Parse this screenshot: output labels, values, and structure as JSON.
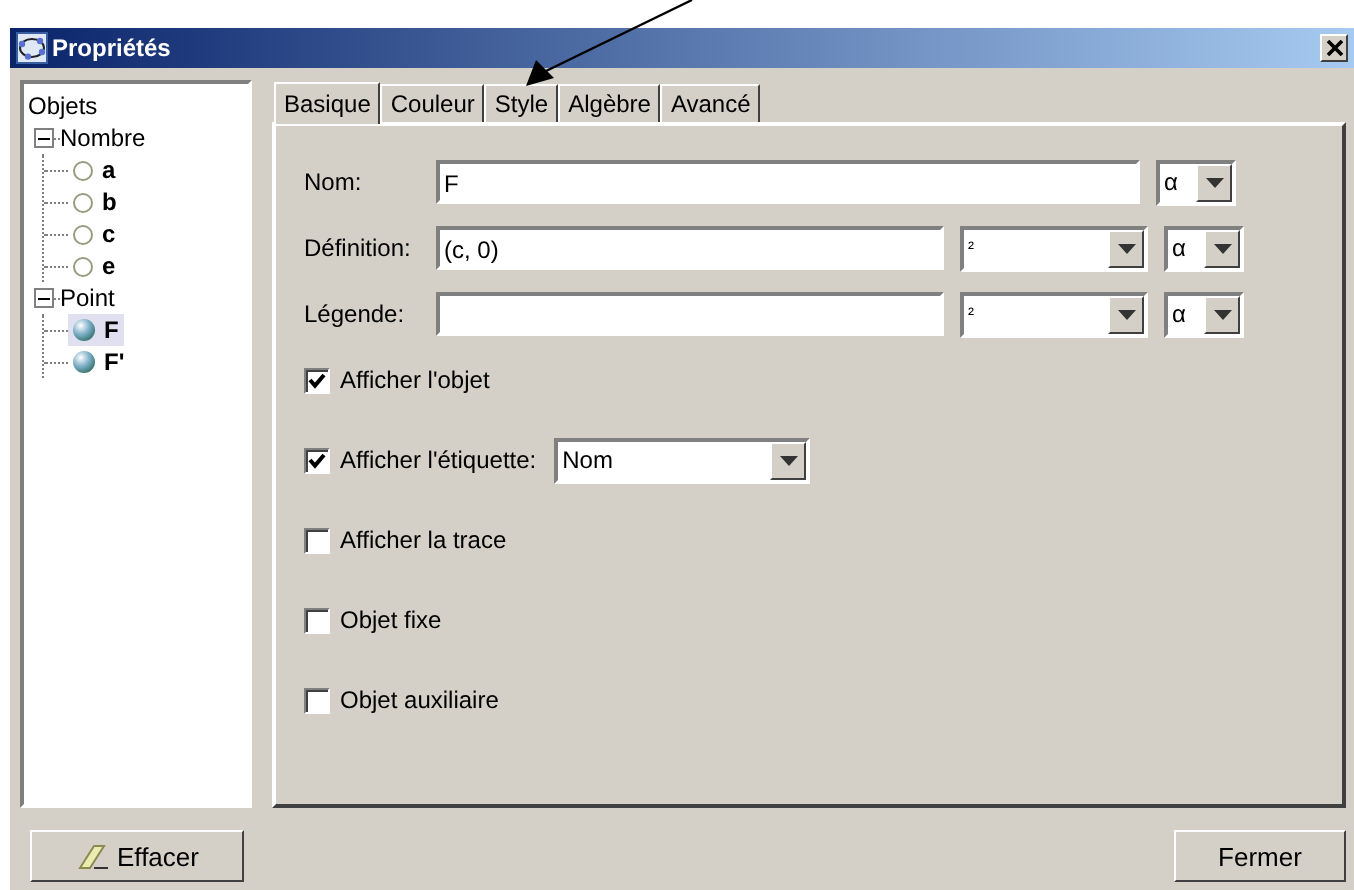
{
  "window": {
    "title": "Propriétés"
  },
  "tree": {
    "label": "Objets",
    "children": [
      {
        "label": "Nombre",
        "expanded": true,
        "children": [
          {
            "label": "a",
            "kind": "number",
            "selected": false
          },
          {
            "label": "b",
            "kind": "number",
            "selected": false
          },
          {
            "label": "c",
            "kind": "number",
            "selected": false
          },
          {
            "label": "e",
            "kind": "number",
            "selected": false
          }
        ]
      },
      {
        "label": "Point",
        "expanded": true,
        "children": [
          {
            "label": "F",
            "kind": "point",
            "selected": true
          },
          {
            "label": "F'",
            "kind": "point",
            "selected": false
          }
        ]
      }
    ]
  },
  "tabs": [
    {
      "label": "Basique",
      "selected": true
    },
    {
      "label": "Couleur",
      "selected": false
    },
    {
      "label": "Style",
      "selected": false
    },
    {
      "label": "Algèbre",
      "selected": false
    },
    {
      "label": "Avancé",
      "selected": false
    }
  ],
  "fields": [
    {
      "label": "Nom:",
      "value": "F",
      "alpha": "α"
    },
    {
      "label": "Définition:",
      "value": "(c, 0)",
      "symbol": "²",
      "alpha": "α"
    },
    {
      "label": "Légende:",
      "symbol": "²",
      "alpha": "α"
    }
  ],
  "checkboxes": [
    {
      "label": "Afficher l'objet",
      "checked": true
    },
    {
      "label": "Afficher l'étiquette:",
      "checked": true,
      "select": "Nom"
    },
    {
      "label": "Afficher la trace",
      "checked": false
    },
    {
      "label": "Objet fixe",
      "checked": false
    },
    {
      "label": "Objet auxiliaire",
      "checked": false
    }
  ],
  "buttons": {
    "left": "Effacer",
    "right": "Fermer"
  }
}
